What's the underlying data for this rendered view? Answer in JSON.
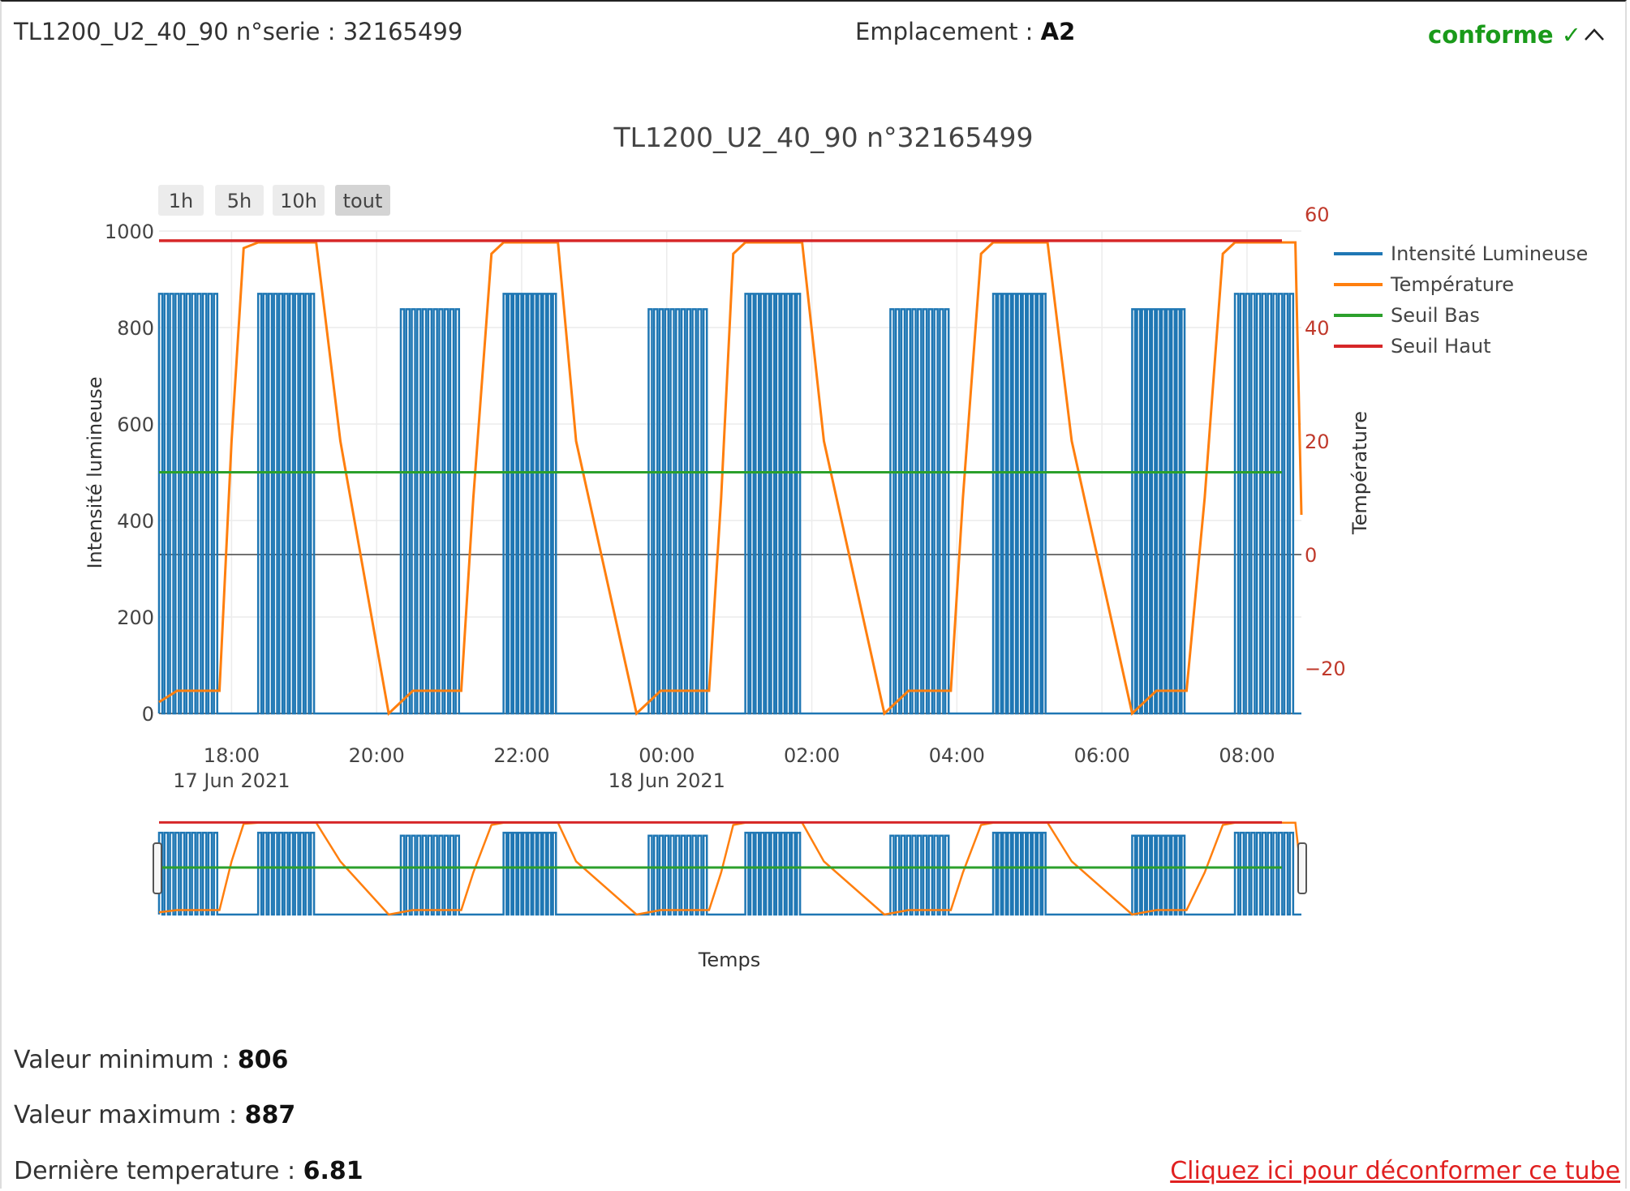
{
  "header": {
    "device_label": "TL1200_U2_40_90 n°serie : 32165499",
    "location_label": "Emplacement : ",
    "location_value": "A2",
    "status_text": "conforme ✓",
    "collapse_icon": "chevron-up-icon"
  },
  "range_selector": {
    "buttons": [
      "1h",
      "5h",
      "10h",
      "tout"
    ],
    "active": "tout"
  },
  "chart_data": {
    "type": "line",
    "title": "TL1200_U2_40_90 n°32165499",
    "xlabel": "Temps",
    "ylabel": "Intensité lumineuse",
    "y2label": "Température",
    "x_range": [
      "2021-06-17 17:00",
      "2021-06-18 08:45"
    ],
    "ylim": [
      0,
      1000
    ],
    "y2lim": [
      -28,
      57
    ],
    "yticks": [
      0,
      200,
      400,
      600,
      800,
      1000
    ],
    "y2ticks": [
      -20,
      0,
      20,
      40,
      60
    ],
    "xticks": [
      {
        "time": "18:00",
        "date": "17 Jun 2021"
      },
      {
        "time": "20:00",
        "date": ""
      },
      {
        "time": "22:00",
        "date": ""
      },
      {
        "time": "00:00",
        "date": "18 Jun 2021"
      },
      {
        "time": "02:00",
        "date": ""
      },
      {
        "time": "04:00",
        "date": ""
      },
      {
        "time": "06:00",
        "date": ""
      },
      {
        "time": "08:00",
        "date": ""
      }
    ],
    "grid": true,
    "legend_position": "right",
    "series": [
      {
        "name": "Intensité Lumineuse",
        "axis": "y",
        "color": "#1f77b4",
        "on_level": [
          {
            "start": "17:00",
            "end": "17:50",
            "level": 870
          },
          {
            "start": "18:22",
            "end": "19:10",
            "level": 870
          },
          {
            "start": "20:20",
            "end": "21:10",
            "level": 838
          },
          {
            "start": "21:45",
            "end": "22:30",
            "level": 870
          },
          {
            "start": "23:45",
            "end": "00:35",
            "level": 838
          },
          {
            "start": "01:05",
            "end": "01:52",
            "level": 870
          },
          {
            "start": "03:05",
            "end": "03:55",
            "level": 838
          },
          {
            "start": "04:30",
            "end": "05:15",
            "level": 870
          },
          {
            "start": "06:25",
            "end": "07:10",
            "level": 838
          },
          {
            "start": "07:50",
            "end": "08:40",
            "level": 870
          }
        ],
        "off_level": 0
      },
      {
        "name": "Température",
        "axis": "y2",
        "color": "#ff7f0e",
        "points": [
          [
            "17:00",
            -26
          ],
          [
            "17:15",
            -24
          ],
          [
            "17:50",
            -24
          ],
          [
            "18:00",
            20
          ],
          [
            "18:10",
            54
          ],
          [
            "18:22",
            55
          ],
          [
            "19:10",
            55
          ],
          [
            "19:30",
            20
          ],
          [
            "20:10",
            -28
          ],
          [
            "20:30",
            -24
          ],
          [
            "21:10",
            -24
          ],
          [
            "21:20",
            10
          ],
          [
            "21:35",
            53
          ],
          [
            "21:45",
            55
          ],
          [
            "22:30",
            55
          ],
          [
            "22:45",
            20
          ],
          [
            "23:35",
            -28
          ],
          [
            "23:55",
            -24
          ],
          [
            "00:35",
            -24
          ],
          [
            "00:45",
            10
          ],
          [
            "00:55",
            53
          ],
          [
            "01:05",
            55
          ],
          [
            "01:52",
            55
          ],
          [
            "02:10",
            20
          ],
          [
            "03:00",
            -28
          ],
          [
            "03:20",
            -24
          ],
          [
            "03:55",
            -24
          ],
          [
            "04:05",
            10
          ],
          [
            "04:20",
            53
          ],
          [
            "04:30",
            55
          ],
          [
            "05:15",
            55
          ],
          [
            "05:35",
            20
          ],
          [
            "06:25",
            -28
          ],
          [
            "06:45",
            -24
          ],
          [
            "07:10",
            -24
          ],
          [
            "07:25",
            10
          ],
          [
            "07:40",
            53
          ],
          [
            "07:50",
            55
          ],
          [
            "08:40",
            55
          ],
          [
            "08:45",
            7
          ]
        ]
      },
      {
        "name": "Seuil Bas",
        "axis": "y",
        "color": "#2ca02c",
        "value": 500
      },
      {
        "name": "Seuil Haut",
        "axis": "y",
        "color": "#d62728",
        "value": 980
      }
    ]
  },
  "stats": {
    "min_label": "Valeur minimum : ",
    "min_value": "806",
    "max_label": "Valeur maximum : ",
    "max_value": "887",
    "temp_label": "Dernière temperature : ",
    "temp_value": "6.81"
  },
  "footer": {
    "link_text": "Cliquez ici pour déconformer ce tube"
  }
}
